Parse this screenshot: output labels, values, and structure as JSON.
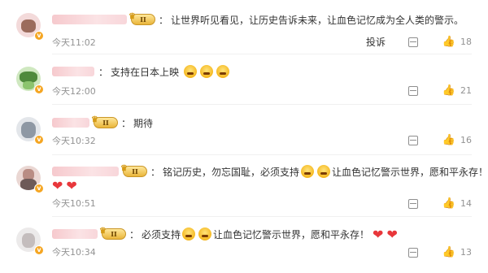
{
  "comments": [
    {
      "text": "让世界听见看见，让历史告诉未来，让血色记忆成为全人类的警示。",
      "time": "今天11:02",
      "likes": "18",
      "report": "投诉",
      "level": "II"
    },
    {
      "text": "支持在日本上映",
      "time": "今天12:00",
      "likes": "21"
    },
    {
      "text": "期待",
      "time": "今天10:32",
      "likes": "16",
      "level": "II"
    },
    {
      "text_a": "铭记历史，勿忘国耻，必须支持",
      "text_b": "让血色记忆警示世界，愿和平永存！",
      "time": "今天10:51",
      "likes": "14",
      "level": "II"
    },
    {
      "text_a": "必须支持",
      "text_b": "让血色记忆警示世界，愿和平永存！",
      "time": "今天10:34",
      "likes": "13",
      "level": "II"
    }
  ],
  "colon": "：",
  "icons": {
    "verified": "v-badge-icon",
    "reply": "reply-icon",
    "like": "thumbs-up-icon",
    "crown": "crown-icon",
    "heart": "heart-emoji",
    "crying": "crying-emoji"
  },
  "colors": {
    "heart": "#e8373b",
    "verified": "#f5a623",
    "meta_text": "#939393"
  }
}
